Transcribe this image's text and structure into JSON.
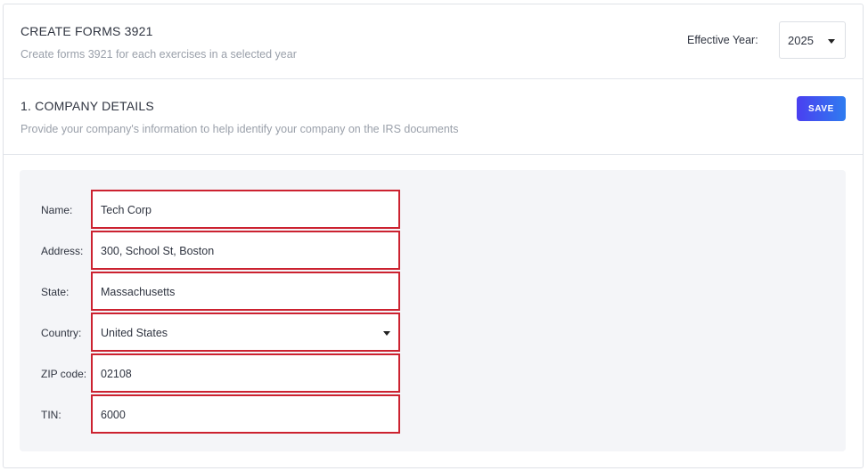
{
  "header": {
    "title": "CREATE FORMS 3921",
    "subtitle": "Create forms 3921 for each exercises in a selected year",
    "year_label": "Effective Year:",
    "year_value": "2025"
  },
  "company": {
    "title": "1. COMPANY DETAILS",
    "subtitle": "Provide your company's information to help identify your company on the IRS documents",
    "save_label": "SAVE"
  },
  "form": {
    "name": {
      "label": "Name:",
      "value": "Tech Corp"
    },
    "address": {
      "label": "Address:",
      "value": "300, School St, Boston"
    },
    "state": {
      "label": "State:",
      "value": "Massachusetts"
    },
    "country": {
      "label": "Country:",
      "value": "United States"
    },
    "zip": {
      "label": "ZIP code:",
      "value": "02108"
    },
    "tin": {
      "label": "TIN:",
      "value": "6000"
    }
  },
  "colors": {
    "field_highlight": "#cc2230",
    "save_gradient_start": "#4a3ff0",
    "save_gradient_end": "#2f7cf0"
  }
}
